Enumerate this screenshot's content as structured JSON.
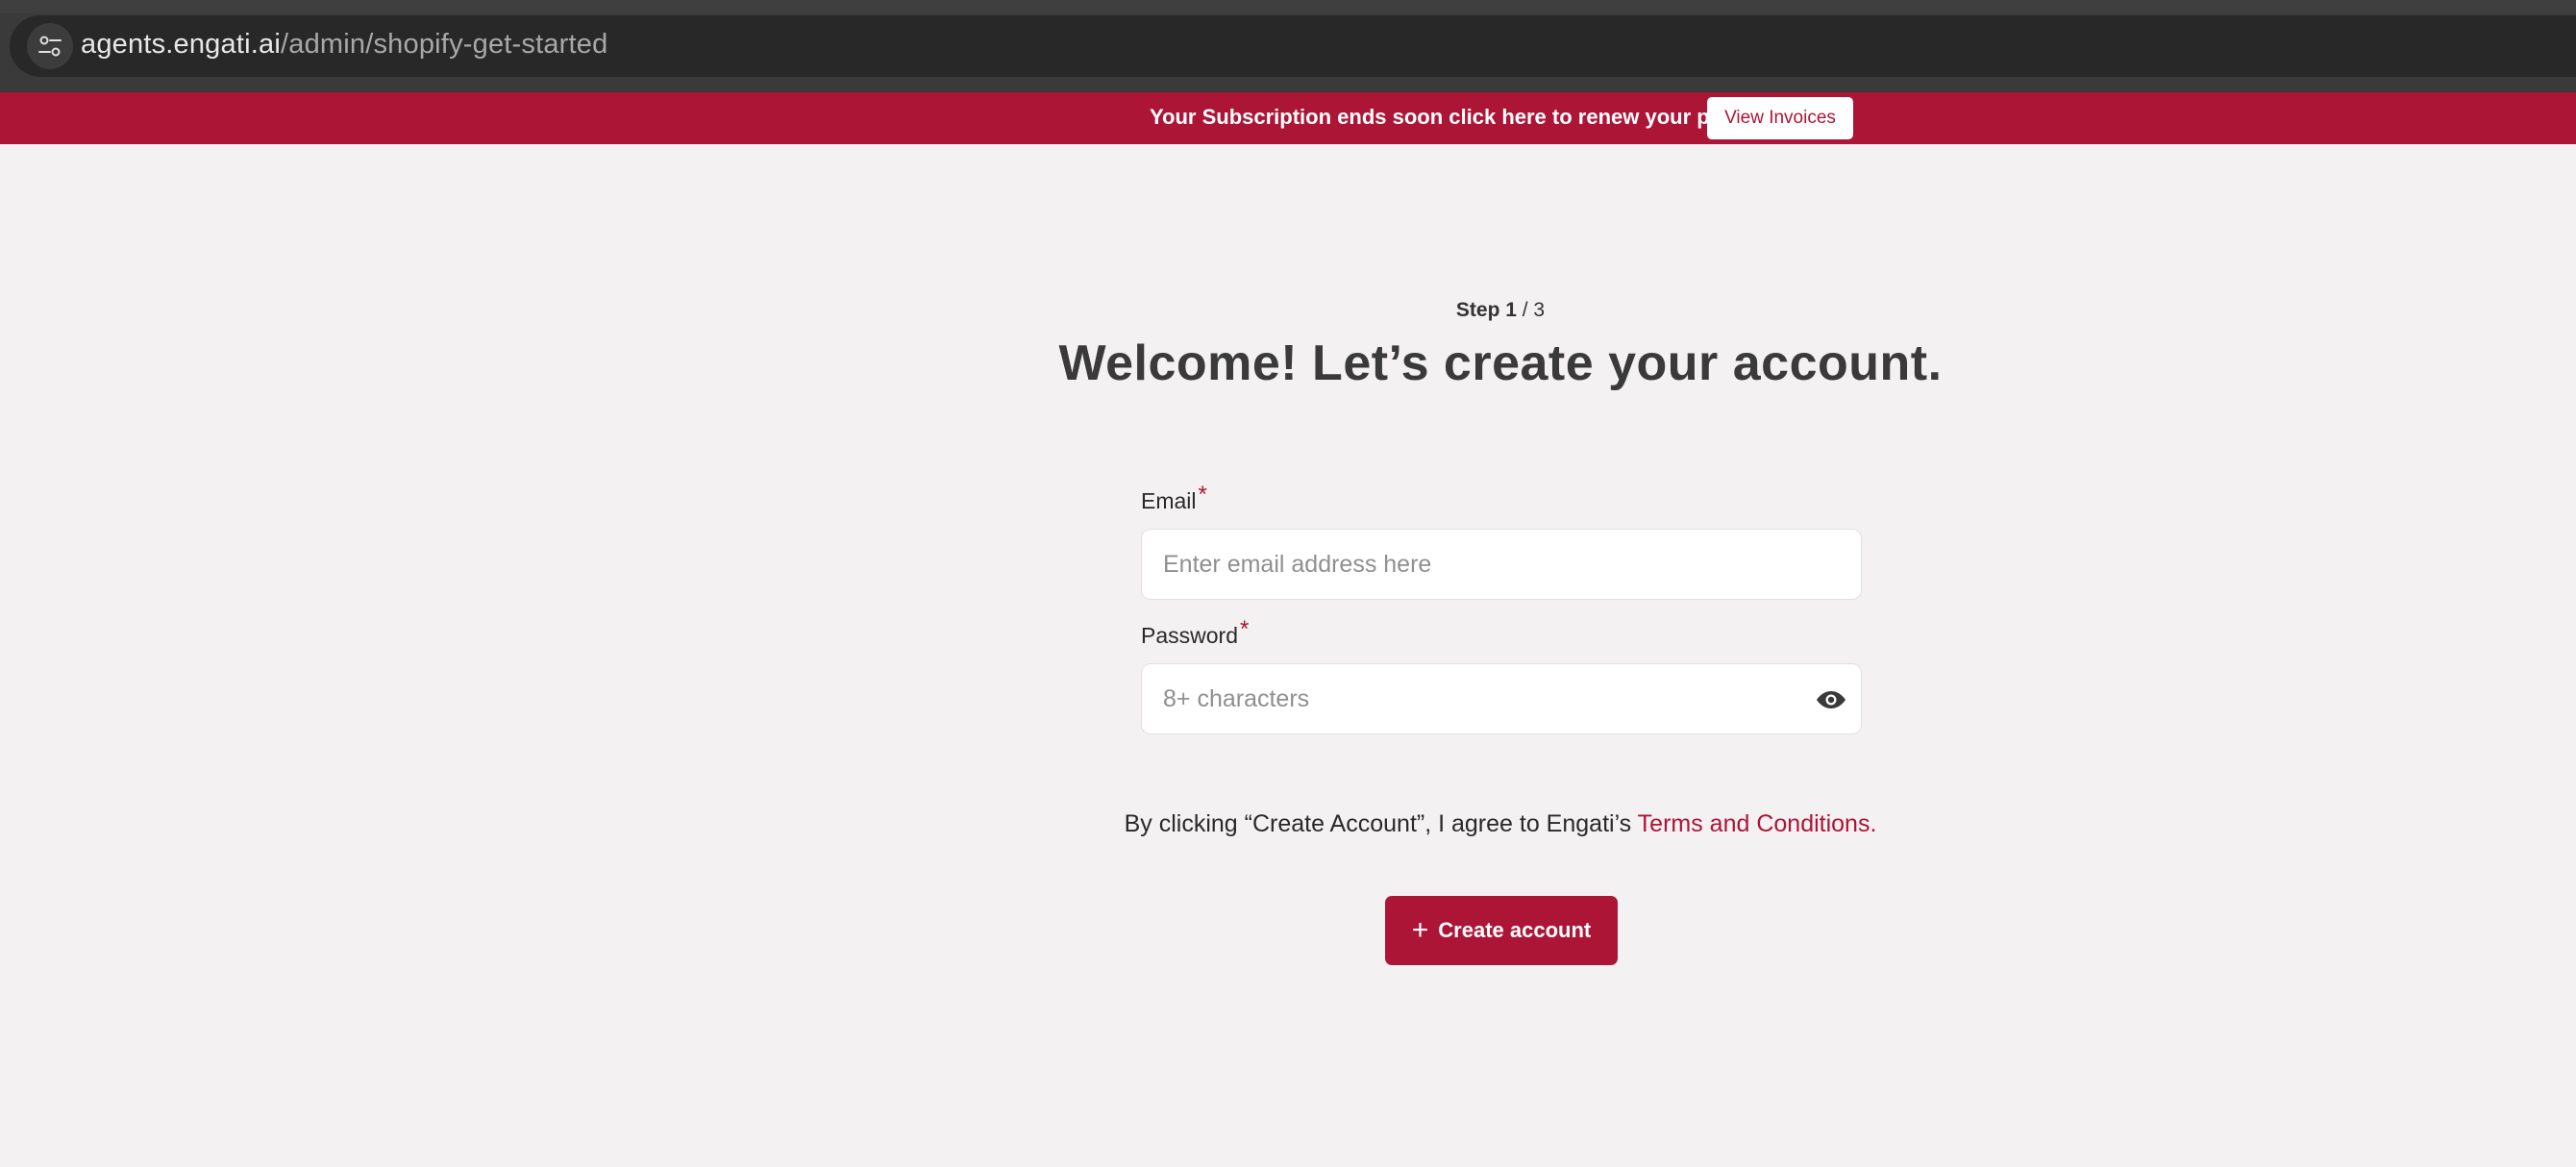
{
  "browser": {
    "url_host": "agents.engati.ai",
    "url_path": "/admin/shopify-get-started",
    "site_info_icon": "tune-icon"
  },
  "banner": {
    "message": "Your Subscription ends soon click here to renew your plan",
    "button_label": "View Invoices",
    "color": "#ad1537"
  },
  "step": {
    "current_label": "Step 1",
    "separator_total": " / 3"
  },
  "page_title": "Welcome! Let’s create your account.",
  "form": {
    "email": {
      "label": "Email",
      "required_mark": "*",
      "placeholder": "Enter email address here",
      "value": ""
    },
    "password": {
      "label": "Password",
      "required_mark": "*",
      "placeholder": "8+ characters",
      "value": "",
      "toggle_icon": "eye-icon"
    }
  },
  "terms": {
    "prefix": "By clicking “Create Account”, I agree to Engati’s ",
    "link_text": "Terms and Conditions."
  },
  "submit": {
    "icon": "+",
    "label": "Create account"
  },
  "colors": {
    "accent": "#ad1537",
    "background": "#f3f1f2"
  }
}
